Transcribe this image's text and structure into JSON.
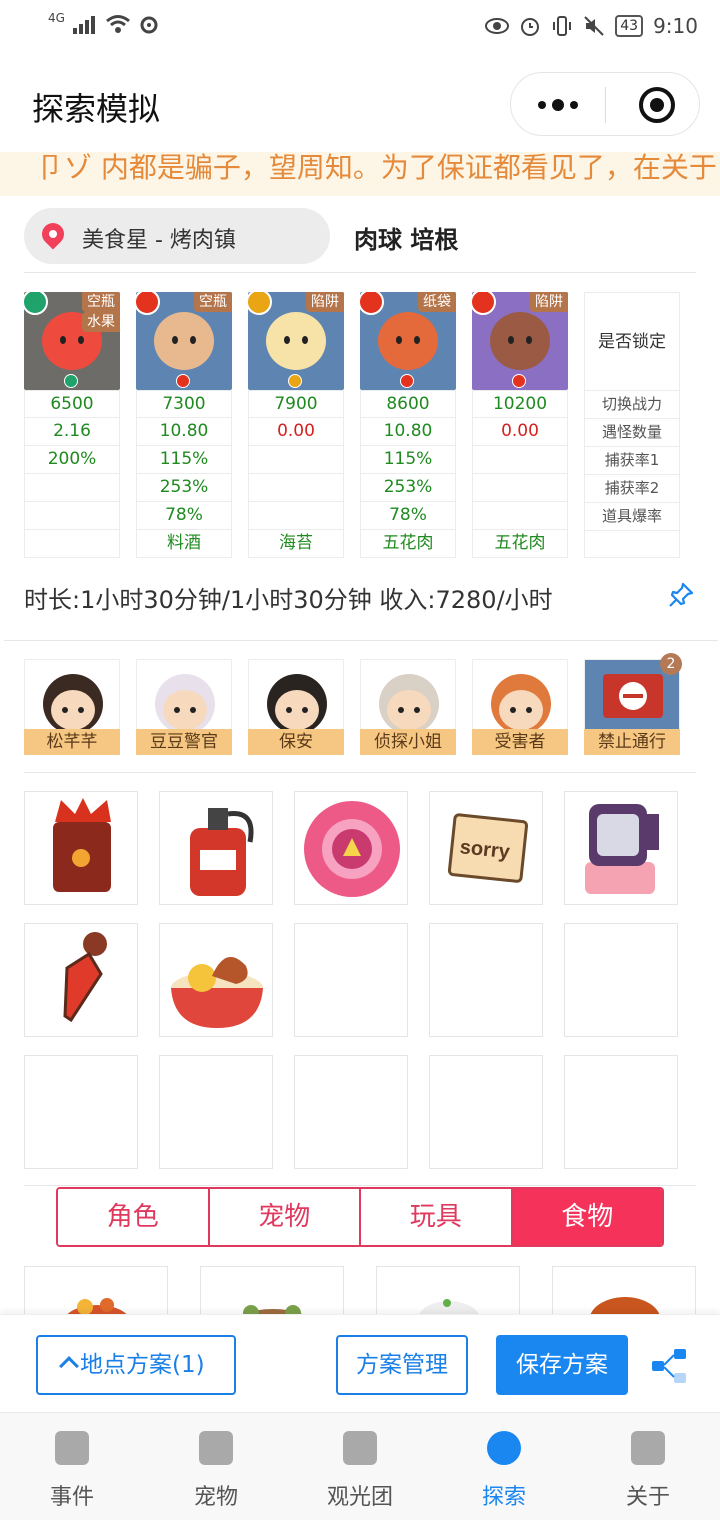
{
  "status_bar": {
    "network": "4G",
    "battery": "43",
    "time": "9:10"
  },
  "header": {
    "title": "探索模拟"
  },
  "notice": {
    "text": "卩ゾ 内都是骗子，望周知。为了保证都看见了，在关于"
  },
  "location": {
    "name": "美食星 - 烤肉镇",
    "team": "肉球 培根"
  },
  "pets": [
    {
      "tag": "空瓶",
      "tag2": "水果",
      "elem_color": "#1fa36a",
      "bg": "#6e6c68",
      "face": "#ee4b3e",
      "stats": [
        "6500",
        "2.16",
        "200%",
        "",
        "",
        ""
      ]
    },
    {
      "tag": "空瓶",
      "tag2": "",
      "elem_color": "#e3321e",
      "bg": "#5e84b2",
      "face": "#e8b98e",
      "stats": [
        "7300",
        "10.80",
        "115%",
        "253%",
        "78%",
        "料酒"
      ]
    },
    {
      "tag": "陷阱",
      "tag2": "",
      "elem_color": "#e9a514",
      "bg": "#5e84b2",
      "face": "#f7e3a8",
      "stats": [
        "7900",
        "0.00",
        "",
        "",
        "",
        "海苔"
      ]
    },
    {
      "tag": "纸袋",
      "tag2": "",
      "elem_color": "#e3321e",
      "bg": "#5e84b2",
      "face": "#e46a3c",
      "stats": [
        "8600",
        "10.80",
        "115%",
        "253%",
        "78%",
        "五花肉"
      ]
    },
    {
      "tag": "陷阱",
      "tag2": "",
      "elem_color": "#e3321e",
      "bg": "#8a6fc2",
      "face": "#9b5a43",
      "stats": [
        "10200",
        "0.00",
        "",
        "",
        "",
        "五花肉"
      ]
    }
  ],
  "lock_column": {
    "header": "是否锁定",
    "labels": [
      "切换战力",
      "遇怪数量",
      "捕获率1",
      "捕获率2",
      "道具爆率"
    ]
  },
  "summary": {
    "text": "时长:1小时30分钟/1小时30分钟 收入:7280/小时"
  },
  "characters": [
    {
      "name": "松芊芊",
      "badge": ""
    },
    {
      "name": "豆豆警官",
      "badge": ""
    },
    {
      "name": "保安",
      "badge": ""
    },
    {
      "name": "侦探小姐",
      "badge": ""
    },
    {
      "name": "受害者",
      "badge": ""
    },
    {
      "name": "禁止通行",
      "badge": "2"
    }
  ],
  "items": [
    {
      "icon": "spice-bag-icon",
      "label": ""
    },
    {
      "icon": "fire-extinguisher-icon",
      "label": ""
    },
    {
      "icon": "flower-medal-icon",
      "label": ""
    },
    {
      "icon": "sorry-note-icon",
      "label": "sorry"
    },
    {
      "icon": "kettle-icon",
      "label": ""
    },
    {
      "icon": "dropper-icon",
      "label": ""
    },
    {
      "icon": "food-bowl-icon",
      "label": ""
    }
  ],
  "category_tabs": [
    "角色",
    "宠物",
    "玩具",
    "食物"
  ],
  "active_category": "食物",
  "actions": {
    "location_plan": "地点方案(1)",
    "plan_manage": "方案管理",
    "save_plan": "保存方案"
  },
  "tabbar": [
    "事件",
    "宠物",
    "观光团",
    "探索",
    "关于"
  ],
  "active_tab": "探索",
  "colors": {
    "accent_blue": "#1a86f0",
    "accent_red": "#f5325a",
    "stat_green": "#1f8a1f",
    "stat_red": "#d62020"
  }
}
